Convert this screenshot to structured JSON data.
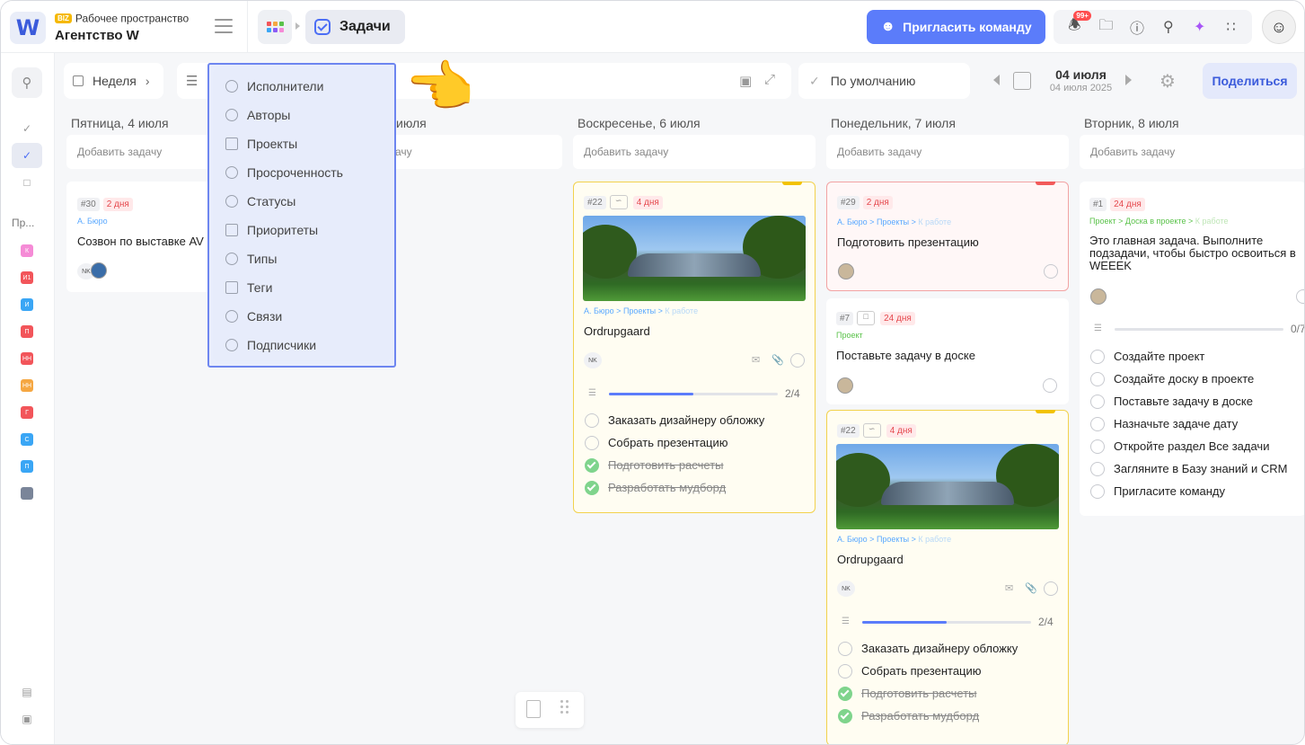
{
  "app": {
    "logo": "W",
    "workspace_badge": "BIZ",
    "workspace_label": "Рабочее пространство",
    "workspace_name": "Агентство W",
    "current_section": "Задачи",
    "invite_label": "Пригласить команду",
    "notif_count": "99+"
  },
  "sidebar": {
    "section_label": "Пр...",
    "projects": [
      {
        "label": "К",
        "color": "#f58bd6"
      },
      {
        "label": "И1",
        "color": "#f2555a"
      },
      {
        "label": "И",
        "color": "#3aa6f5"
      },
      {
        "label": "П",
        "color": "#f2555a"
      },
      {
        "label": "НН",
        "color": "#f2555a"
      },
      {
        "label": "НН",
        "color": "#f5a742"
      },
      {
        "label": "Г",
        "color": "#f2555a"
      },
      {
        "label": "С",
        "color": "#3aa6f5"
      },
      {
        "label": "П",
        "color": "#3aa6f5"
      }
    ]
  },
  "toolbar": {
    "view_label": "Неделя",
    "sort_label": "По умолчанию",
    "date_main": "04 июля",
    "date_sub": "04 июля 2025",
    "share_label": "Поделиться"
  },
  "filter_menu": {
    "items": [
      "Исполнители",
      "Авторы",
      "Проекты",
      "Просроченность",
      "Статусы",
      "Приоритеты",
      "Типы",
      "Теги",
      "Связи",
      "Подписчики"
    ]
  },
  "columns": [
    {
      "title": "Пятница, 4 июля",
      "add": "Добавить задачу"
    },
    {
      "title": "июля",
      "add": "ачу"
    },
    {
      "title": "Воскресенье, 6 июля",
      "add": "Добавить задачу"
    },
    {
      "title": "Понедельник, 7 июля",
      "add": "Добавить задачу"
    },
    {
      "title": "Вторник, 8 июля",
      "add": "Добавить задачу"
    }
  ],
  "cards": {
    "c30": {
      "num": "#30",
      "days": "2 дня",
      "crumb": "А. Бюро",
      "title": "Созвон по выставке AV",
      "assignee": "NK"
    },
    "c22a": {
      "num": "#22",
      "days": "4 дня",
      "crumb1": "А. Бюро",
      "crumb2": "Проекты",
      "crumb3": "К работе",
      "title": "Ordrupgaard",
      "assignee": "NK",
      "progress_text": "2/4",
      "progress": 0.5,
      "subtasks": [
        {
          "text": "Заказать дизайнеру обложку",
          "done": false
        },
        {
          "text": "Собрать презентацию",
          "done": false
        },
        {
          "text": "Подготовить расчеты",
          "done": true
        },
        {
          "text": "Разработать мудборд",
          "done": true
        }
      ]
    },
    "c29": {
      "num": "#29",
      "days": "2 дня",
      "crumb1": "А. Бюро",
      "crumb2": "Проекты",
      "crumb3": "К работе",
      "title": "Подготовить презентацию"
    },
    "c7": {
      "num": "#7",
      "days": "24 дня",
      "crumb": "Проект",
      "title": "Поставьте задачу в доске"
    },
    "c22b": {
      "num": "#22",
      "days": "4 дня",
      "crumb1": "А. Бюро",
      "crumb2": "Проекты",
      "crumb3": "К работе",
      "title": "Ordrupgaard",
      "assignee": "NK",
      "progress_text": "2/4",
      "progress": 0.5,
      "subtasks": [
        {
          "text": "Заказать дизайнеру обложку",
          "done": false
        },
        {
          "text": "Собрать презентацию",
          "done": false
        },
        {
          "text": "Подготовить расчеты",
          "done": true
        },
        {
          "text": "Разработать мудборд",
          "done": true
        }
      ]
    },
    "c1": {
      "num": "#1",
      "days": "24 дня",
      "crumb1": "Проект",
      "crumb2": "Доска в проекте",
      "crumb3": "К работе",
      "title": "Это главная задача. Выполните подзадачи, чтобы быстро освоиться в WEEEK",
      "progress_text": "0/7",
      "subtasks": [
        {
          "text": "Создайте проект",
          "done": false
        },
        {
          "text": "Создайте доску в проекте",
          "done": false
        },
        {
          "text": "Поставьте задачу в доске",
          "done": false
        },
        {
          "text": "Назначьте задаче дату",
          "done": false
        },
        {
          "text": "Откройте раздел Все задачи",
          "done": false
        },
        {
          "text": "Загляните в Базу знаний и CRM",
          "done": false
        },
        {
          "text": "Пригласите команду",
          "done": false
        }
      ]
    }
  },
  "colors": {
    "accent": "#5b7cfa",
    "overdue": "#e5484d"
  }
}
